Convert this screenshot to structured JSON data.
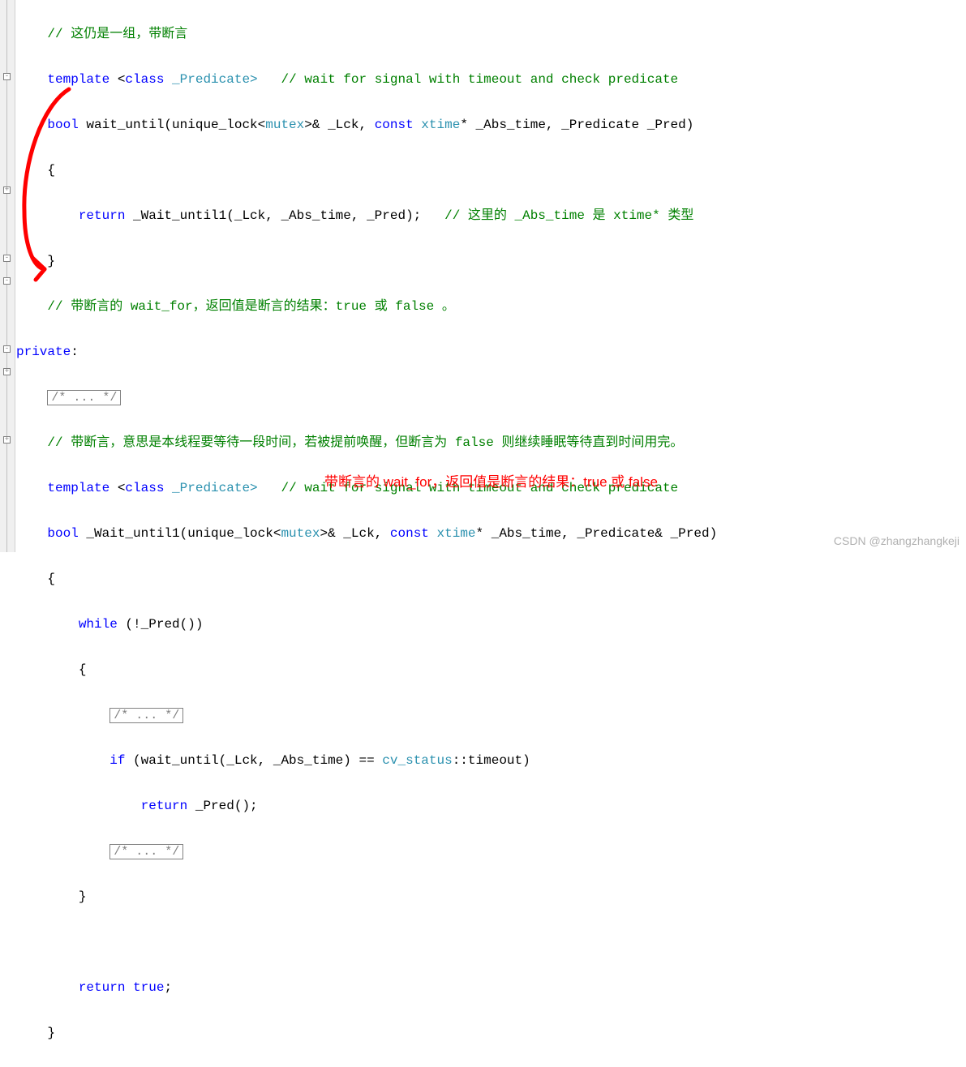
{
  "lines": {
    "l1_comment": "// 这仍是一组，带断言",
    "l2_a": "template",
    "l2_b": " <",
    "l2_c": "class",
    "l2_d": " _Predicate>   ",
    "l2_e": "// wait for signal with timeout and check predicate",
    "l3_a": "bool",
    "l3_b": " wait_until(unique_lock<",
    "l3_c": "mutex",
    "l3_d": ">& _Lck, ",
    "l3_e": "const",
    "l3_f": " xtime",
    "l3_g": "* _Abs_time, _Predicate _Pred)",
    "l4": "{",
    "l5_a": "return",
    "l5_b": " _Wait_until1(_Lck, _Abs_time, _Pred);   ",
    "l5_c": "// 这里的 _Abs_time 是 xtime* 类型",
    "l6": "}",
    "l7": "// 带断言的 wait_for，返回值是断言的结果：true 或 false 。",
    "l8_a": "private",
    "l8_b": ":",
    "l9": "/* ... */",
    "l10": "// 带断言，意思是本线程要等待一段时间，若被提前唤醒，但断言为 false 则继续睡眠等待直到时间用完。",
    "l11_a": "template",
    "l11_b": " <",
    "l11_c": "class",
    "l11_d": " _Predicate>   ",
    "l11_e": "// wait for signal with timeout and check predicate",
    "l12_a": "bool",
    "l12_b": " _Wait_until1(unique_lock<",
    "l12_c": "mutex",
    "l12_d": ">& _Lck, ",
    "l12_e": "const",
    "l12_f": " xtime",
    "l12_g": "* _Abs_time, _Predicate& _Pred)",
    "l13": "{",
    "l14_a": "while",
    "l14_b": " (!_Pred())",
    "l15": "{",
    "l16": "/* ... */",
    "l17_a": "if",
    "l17_b": " (wait_until(_Lck, _Abs_time) == ",
    "l17_c": "cv_status",
    "l17_d": "::timeout)",
    "l18_a": "return",
    "l18_b": " _Pred();",
    "l19": "/* ... */",
    "l20": "}",
    "l21": "",
    "l22_a": "return",
    "l22_b": " ",
    "l22_c": "true",
    "l22_d": ";",
    "l23": "}"
  },
  "red_note": "带断言的 wait_for，返回值是断言的结果：true 或 false",
  "watermark": "CSDN @zhangzhangkeji",
  "indent": {
    "i1": "    ",
    "i2": "        ",
    "i3": "            ",
    "i4": "                "
  }
}
